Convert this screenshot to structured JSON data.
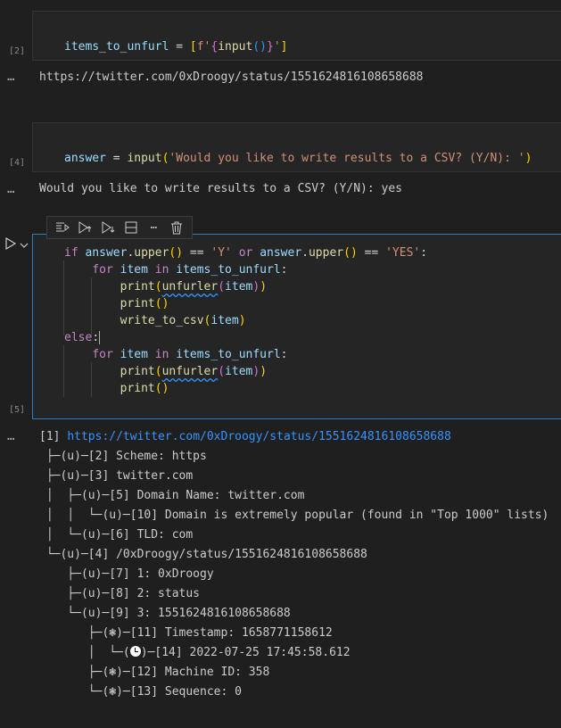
{
  "cells": [
    {
      "exec_count": "[2]",
      "code_line": "items_to_unfurl = [f'{input()}']",
      "output": "https://twitter.com/0xDroogy/status/1551624816108658688"
    },
    {
      "exec_count": "[4]",
      "code_line": "answer = input('Would you like to write results to a CSV? (Y/N): ')",
      "output": "Would you like to write results to a CSV? (Y/N): yes"
    },
    {
      "exec_count": "[5]",
      "code_lines": [
        "if answer.upper() == 'Y' or answer.upper() == 'YES':",
        "    for item in items_to_unfurl:",
        "        print(unfurler(item))",
        "        print()",
        "        write_to_csv(item)",
        "else:",
        "    for item in items_to_unfurl:",
        "        print(unfurler(item))",
        "        print()"
      ]
    }
  ],
  "output_dots": "…",
  "tree_output": {
    "root_prefix": "[1] ",
    "root_link": "https://twitter.com/0xDroogy/status/1551624816108658688",
    "lines": [
      " ├─(u)─[2] Scheme: https",
      " ├─(u)─[3] twitter.com",
      " │  ├─(u)─[5] Domain Name: twitter.com",
      " │  │  └─(u)─[10] Domain is extremely popular (found in \"Top 1000\" lists)",
      " │  └─(u)─[6] TLD: com",
      " └─(u)─[4] /0xDroogy/status/1551624816108658688",
      "    ├─(u)─[7] 1: 0xDroogy",
      "    ├─(u)─[8] 2: status",
      "    └─(u)─[9] 3: 1551624816108658688",
      "       ├─(❃)─[11] Timestamp: 1658771158612",
      "       │  └─(",
      "       ├─(❃)─[12] Machine ID: 358",
      "       └─(❃)─[13] Sequence: 0"
    ],
    "clock_suffix": ")─[14] 2022-07-25 17:45:58.612"
  },
  "toolbar": [
    "run-by-line-icon",
    "execute-above-icon",
    "execute-below-icon",
    "split-cell-icon",
    "more-icon",
    "delete-icon"
  ],
  "colors": {
    "accent": "#2a7fbf",
    "link": "#3794ff",
    "background": "#1f1f1f"
  }
}
